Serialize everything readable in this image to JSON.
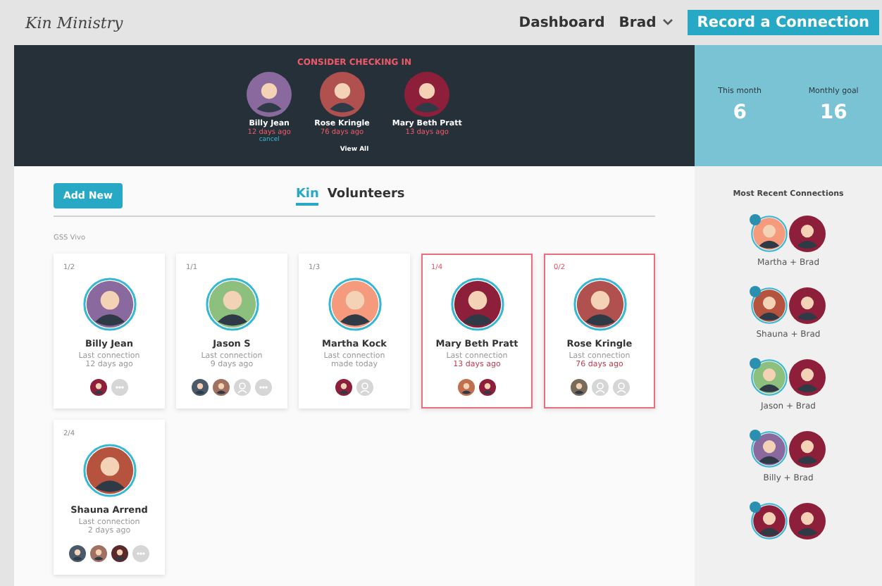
{
  "nav": {
    "logo": "Kin Ministry",
    "links": [
      "Dashboard"
    ],
    "user": "Brad",
    "cta": "Record a Connection"
  },
  "banner": {
    "heading": "CONSIDER CHECKING IN",
    "people": [
      {
        "name": "Billy Jean",
        "time": "12 days ago",
        "note": "cancel",
        "color": "#8a6a9e"
      },
      {
        "name": "Rose Kringle",
        "time": "76 days ago",
        "color": "#b0504f"
      },
      {
        "name": "Mary Beth Pratt",
        "time": "13 days ago",
        "color": "#8e1f3a"
      }
    ],
    "view_all": "View All"
  },
  "stats": [
    {
      "label": "This month",
      "value": "6"
    },
    {
      "label": "Monthly goal",
      "value": "16"
    }
  ],
  "add_button": "Add New",
  "tabs": [
    {
      "label": "Kin",
      "selected": true
    },
    {
      "label": "Volunteers",
      "selected": false
    }
  ],
  "section": "GSS Vivo",
  "cards": [
    {
      "count": "1/2",
      "name": "Billy Jean",
      "caption": "Last connection",
      "time": "12 days ago",
      "alert": false,
      "color": "#8a6a9e",
      "connections": [
        {
          "kind": "photo",
          "color": "#8e1f3a"
        },
        {
          "kind": "more"
        }
      ]
    },
    {
      "count": "1/1",
      "name": "Jason S",
      "caption": "Last connection",
      "time": "9 days ago",
      "alert": false,
      "color": "#8dbf7f",
      "connections": [
        {
          "kind": "photo",
          "color": "#4a5a6a"
        },
        {
          "kind": "photo",
          "color": "#a07060"
        },
        {
          "kind": "empty"
        },
        {
          "kind": "more"
        }
      ]
    },
    {
      "count": "1/3",
      "name": "Martha Kock",
      "caption": "Last connection",
      "time": "made today",
      "alert": false,
      "color": "#f59a7c",
      "connections": [
        {
          "kind": "photo",
          "color": "#8e1f3a"
        },
        {
          "kind": "empty"
        }
      ]
    },
    {
      "count": "1/4",
      "name": "Mary Beth Pratt",
      "caption": "Last connection",
      "time": "13 days ago",
      "alert": true,
      "color": "#8e1f3a",
      "connections": [
        {
          "kind": "photo",
          "color": "#c0704f"
        },
        {
          "kind": "photo",
          "color": "#8e1f3a"
        }
      ]
    },
    {
      "count": "0/2",
      "name": "Rose Kringle",
      "caption": "Last connection",
      "time": "76 days ago",
      "alert": true,
      "color": "#b0504f",
      "connections": [
        {
          "kind": "photo",
          "color": "#7a6a5a"
        },
        {
          "kind": "empty"
        },
        {
          "kind": "empty"
        }
      ]
    },
    {
      "count": "2/4",
      "name": "Shauna Arrend",
      "caption": "Last connection",
      "time": "2 days ago",
      "alert": false,
      "color": "#b5533f",
      "connections": [
        {
          "kind": "photo",
          "color": "#4a5a6a"
        },
        {
          "kind": "photo",
          "color": "#a07060"
        },
        {
          "kind": "photo",
          "color": "#5a2a2a"
        },
        {
          "kind": "more"
        }
      ]
    }
  ],
  "recent": {
    "title": "Most Recent Connections",
    "items": [
      {
        "label": "Martha + Brad",
        "color": "#f59a7c"
      },
      {
        "label": "Shauna + Brad",
        "color": "#b5533f"
      },
      {
        "label": "Jason + Brad",
        "color": "#8dbf7f"
      },
      {
        "label": "Billy + Brad",
        "color": "#8a6a9e"
      },
      {
        "color": "#8e1f3a"
      }
    ]
  }
}
